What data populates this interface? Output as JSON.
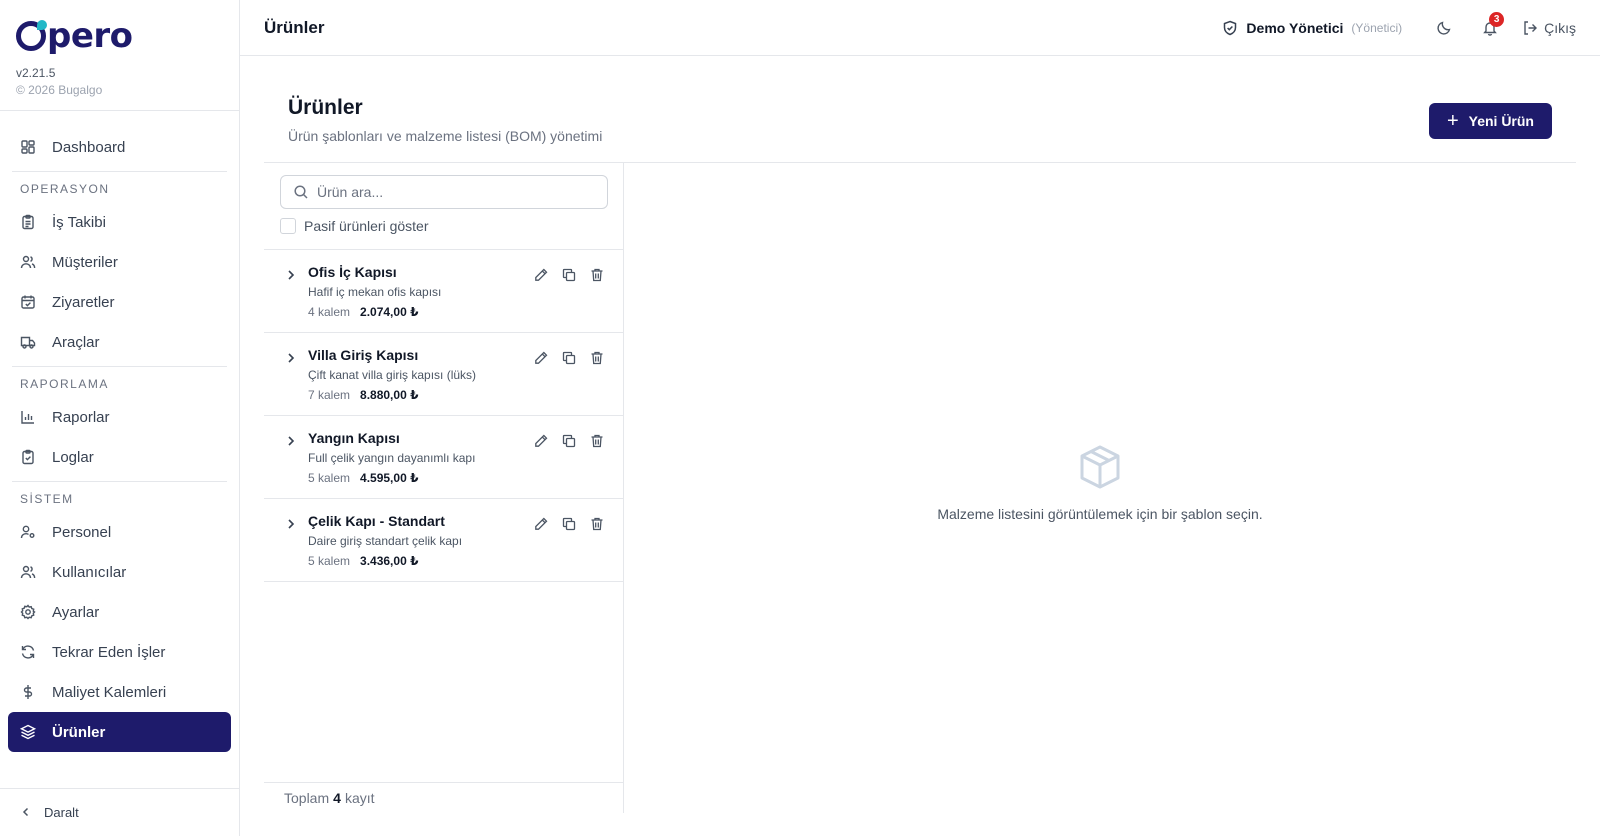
{
  "app": {
    "logo_text": "pero",
    "version": "v2.21.5",
    "copyright": "© 2026 Bugalgo",
    "brand_color": "#1e1b6b"
  },
  "sidebar": {
    "dashboard": "Dashboard",
    "sections": {
      "operasyon": "OPERASYON",
      "raporlama": "RAPORLAMA",
      "sistem": "SİSTEM"
    },
    "items": {
      "is_takibi": "İş Takibi",
      "musteriler": "Müşteriler",
      "ziyaretler": "Ziyaretler",
      "araclar": "Araçlar",
      "raporlar": "Raporlar",
      "loglar": "Loglar",
      "personel": "Personel",
      "kullanicilar": "Kullanıcılar",
      "ayarlar": "Ayarlar",
      "tekrar_eden": "Tekrar Eden İşler",
      "maliyet": "Maliyet Kalemleri",
      "urunler": "Ürünler"
    },
    "collapse_label": "Daralt"
  },
  "topbar": {
    "title": "Ürünler",
    "user_name": "Demo Yönetici",
    "user_role": "(Yönetici)",
    "notification_count": "3",
    "logout_label": "Çıkış"
  },
  "page": {
    "title": "Ürünler",
    "subtitle": "Ürün şablonları ve malzeme listesi (BOM) yönetimi",
    "new_button": "Yeni Ürün"
  },
  "list_panel": {
    "search_placeholder": "Ürün ara...",
    "show_passive_label": "Pasif ürünleri göster",
    "footer_prefix": "Toplam",
    "footer_count": "4",
    "footer_suffix": "kayıt"
  },
  "products": [
    {
      "name": "Ofis İç Kapısı",
      "desc": "Hafif iç mekan ofis kapısı",
      "items": "4 kalem",
      "price": "2.074,00 ₺"
    },
    {
      "name": "Villa Giriş Kapısı",
      "desc": "Çift kanat villa giriş kapısı (lüks)",
      "items": "7 kalem",
      "price": "8.880,00 ₺"
    },
    {
      "name": "Yangın Kapısı",
      "desc": "Full çelik yangın dayanımlı kapı",
      "items": "5 kalem",
      "price": "4.595,00 ₺"
    },
    {
      "name": "Çelik Kapı - Standart",
      "desc": "Daire giriş standart çelik kapı",
      "items": "5 kalem",
      "price": "3.436,00 ₺"
    }
  ],
  "empty_state": {
    "message": "Malzeme listesini görüntülemek için bir şablon seçin."
  }
}
